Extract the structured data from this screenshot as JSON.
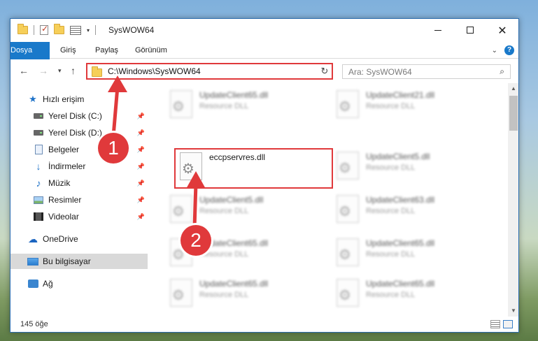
{
  "window": {
    "title": "SysWOW64",
    "minimize_glyph": "",
    "maximize_glyph": "",
    "close_glyph": "✕"
  },
  "ribbon": {
    "tabs": [
      "Dosya",
      "Giriş",
      "Paylaş",
      "Görünüm"
    ]
  },
  "address": {
    "path": "C:\\Windows\\SysWOW64",
    "search_placeholder": "Ara: SysWOW64"
  },
  "nav": {
    "items": [
      {
        "label": "Hızlı erişim",
        "icon": "star-icon",
        "pinned": false
      },
      {
        "label": "Yerel Disk (C:)",
        "icon": "disk-icon",
        "pinned": true
      },
      {
        "label": "Yerel Disk (D:)",
        "icon": "disk-icon",
        "pinned": true
      },
      {
        "label": "Belgeler",
        "icon": "document-icon",
        "pinned": true
      },
      {
        "label": "İndirmeler",
        "icon": "download-icon",
        "pinned": true
      },
      {
        "label": "Müzik",
        "icon": "music-icon",
        "pinned": true
      },
      {
        "label": "Resimler",
        "icon": "pictures-icon",
        "pinned": true
      },
      {
        "label": "Videolar",
        "icon": "video-icon",
        "pinned": true
      },
      {
        "label": "OneDrive",
        "icon": "cloud-icon",
        "pinned": false
      },
      {
        "label": "Bu bilgisayar",
        "icon": "computer-icon",
        "pinned": false,
        "selected": true
      },
      {
        "label": "Ağ",
        "icon": "network-icon",
        "pinned": false
      }
    ]
  },
  "files": [
    {
      "name": "UpdateClient65.dll",
      "type": "Resource DLL",
      "highlighted": false
    },
    {
      "name": "UpdateClient21.dll",
      "type": "Resource DLL",
      "highlighted": false
    },
    {
      "name": "eccpservres.dll",
      "type": "",
      "highlighted": true
    },
    {
      "name": "UpdateClient5.dll",
      "type": "Resource DLL",
      "highlighted": false
    },
    {
      "name": "UpdateClient5.dll",
      "type": "Resource DLL",
      "highlighted": false
    },
    {
      "name": "UpdateClient63.dll",
      "type": "Resource DLL",
      "highlighted": false
    },
    {
      "name": "UpdateClient65.dll",
      "type": "Resource DLL",
      "highlighted": false
    },
    {
      "name": "UpdateClient65.dll",
      "type": "Resource DLL",
      "highlighted": false
    },
    {
      "name": "UpdateClient65.dll",
      "type": "Resource DLL",
      "highlighted": false
    },
    {
      "name": "UpdateClient65.dll",
      "type": "Resource DLL",
      "highlighted": false
    }
  ],
  "status": {
    "count": "145 öğe"
  },
  "annotations": {
    "marker1": "1",
    "marker2": "2",
    "color": "#e0393b"
  }
}
